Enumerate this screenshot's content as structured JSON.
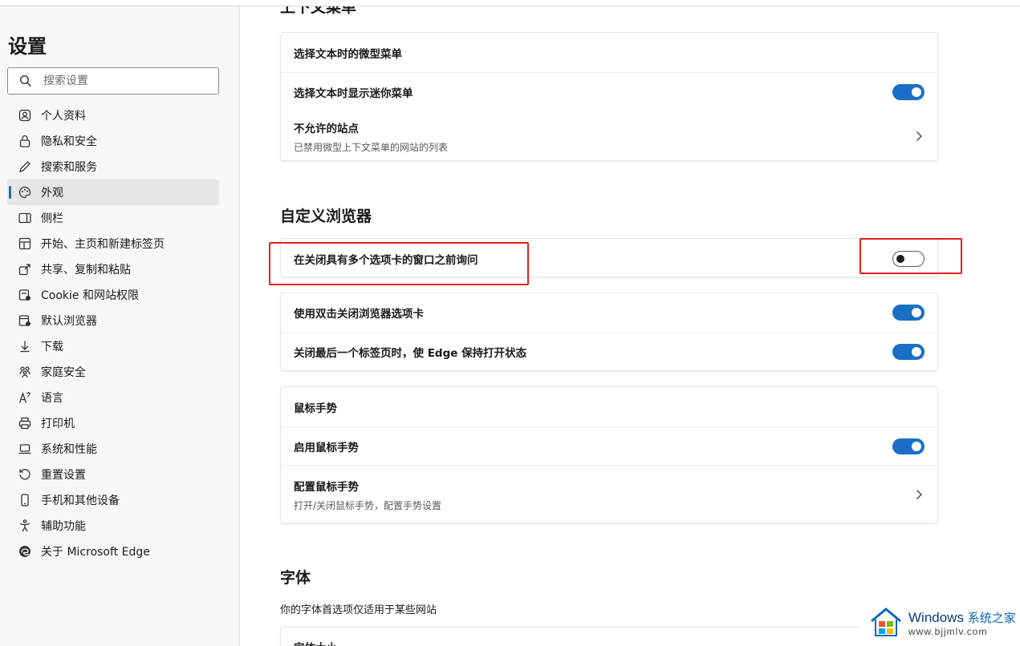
{
  "sidebar": {
    "title": "设置",
    "search_placeholder": "搜索设置",
    "items": [
      {
        "label": "个人资料",
        "icon": "profile-icon"
      },
      {
        "label": "隐私和安全",
        "icon": "lock-icon"
      },
      {
        "label": "搜索和服务",
        "icon": "pen-icon"
      },
      {
        "label": "外观",
        "icon": "palette-icon",
        "active": true
      },
      {
        "label": "侧栏",
        "icon": "sidebar-panel-icon"
      },
      {
        "label": "开始、主页和新建标签页",
        "icon": "home-grid-icon"
      },
      {
        "label": "共享、复制和粘贴",
        "icon": "share-icon"
      },
      {
        "label": "Cookie 和网站权限",
        "icon": "cookie-site-icon"
      },
      {
        "label": "默认浏览器",
        "icon": "default-browser-icon"
      },
      {
        "label": "下载",
        "icon": "download-icon"
      },
      {
        "label": "家庭安全",
        "icon": "family-icon"
      },
      {
        "label": "语言",
        "icon": "language-icon"
      },
      {
        "label": "打印机",
        "icon": "printer-icon"
      },
      {
        "label": "系统和性能",
        "icon": "laptop-icon"
      },
      {
        "label": "重置设置",
        "icon": "reset-icon"
      },
      {
        "label": "手机和其他设备",
        "icon": "phone-icon"
      },
      {
        "label": "辅助功能",
        "icon": "accessibility-icon"
      },
      {
        "label": "关于 Microsoft Edge",
        "icon": "edge-logo-icon"
      }
    ]
  },
  "main": {
    "context_menu_title": "上下文菜单",
    "context_card": {
      "header": "选择文本时的微型菜单",
      "show_mini_menu": "选择文本时显示迷你菜单",
      "blocked_sites": "不允许的站点",
      "blocked_sites_desc": "已禁用微型上下文菜单的网站的列表"
    },
    "customize_title": "自定义浏览器",
    "ask_before_close": "在关闭具有多个选项卡的窗口之前询问",
    "double_click_close": "使用双击关闭浏览器选项卡",
    "keep_edge_open": "关闭最后一个标签页时，使 Edge 保持打开状态",
    "mouse_card": {
      "header": "鼠标手势",
      "enable": "启用鼠标手势",
      "configure": "配置鼠标手势",
      "configure_desc": "打开/关闭鼠标手势，配置手势设置"
    },
    "fonts_title": "字体",
    "fonts_note": "你的字体首选项仅适用于某些网站",
    "font_size_label": "字体大小"
  },
  "toggles": {
    "show_mini_menu": true,
    "ask_before_close": false,
    "double_click_close": true,
    "keep_edge_open": true,
    "enable_mouse_gesture": true
  },
  "watermark": {
    "brand": "Windows",
    "brand_cn": "系统之家",
    "url": "www.bjjmlv.com"
  },
  "colors": {
    "accent": "#1a6fc4",
    "highlight_box": "#e02020"
  }
}
